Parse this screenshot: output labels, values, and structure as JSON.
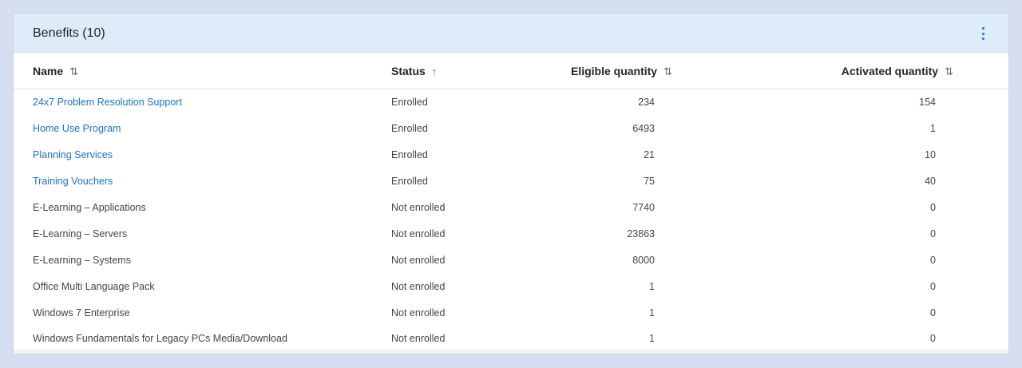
{
  "card": {
    "title": "Benefits (10)"
  },
  "table": {
    "columns": [
      {
        "label": "Name",
        "sort_icon": "⇅"
      },
      {
        "label": "Status",
        "sort_icon": "↑"
      },
      {
        "label": "Eligible quantity",
        "sort_icon": "⇅"
      },
      {
        "label": "Activated quantity",
        "sort_icon": "⇅"
      }
    ],
    "rows": [
      {
        "name": "24x7 Problem Resolution Support",
        "status": "Enrolled",
        "eligible": "234",
        "activated": "154",
        "link": true
      },
      {
        "name": "Home Use Program",
        "status": "Enrolled",
        "eligible": "6493",
        "activated": "1",
        "link": true
      },
      {
        "name": "Planning Services",
        "status": "Enrolled",
        "eligible": "21",
        "activated": "10",
        "link": true
      },
      {
        "name": "Training Vouchers",
        "status": "Enrolled",
        "eligible": "75",
        "activated": "40",
        "link": true
      },
      {
        "name": "E-Learning – Applications",
        "status": "Not enrolled",
        "eligible": "7740",
        "activated": "0",
        "link": false
      },
      {
        "name": "E-Learning – Servers",
        "status": "Not enrolled",
        "eligible": "23863",
        "activated": "0",
        "link": false
      },
      {
        "name": "E-Learning – Systems",
        "status": "Not enrolled",
        "eligible": "8000",
        "activated": "0",
        "link": false
      },
      {
        "name": "Office Multi Language Pack",
        "status": "Not enrolled",
        "eligible": "1",
        "activated": "0",
        "link": false
      },
      {
        "name": "Windows 7 Enterprise",
        "status": "Not enrolled",
        "eligible": "1",
        "activated": "0",
        "link": false
      },
      {
        "name": "Windows Fundamentals for Legacy PCs Media/Download",
        "status": "Not enrolled",
        "eligible": "1",
        "activated": "0",
        "link": false
      }
    ]
  },
  "colors": {
    "link": "#1a73c8",
    "header_bg": "#deebf9",
    "page_bg": "#d5deee"
  }
}
